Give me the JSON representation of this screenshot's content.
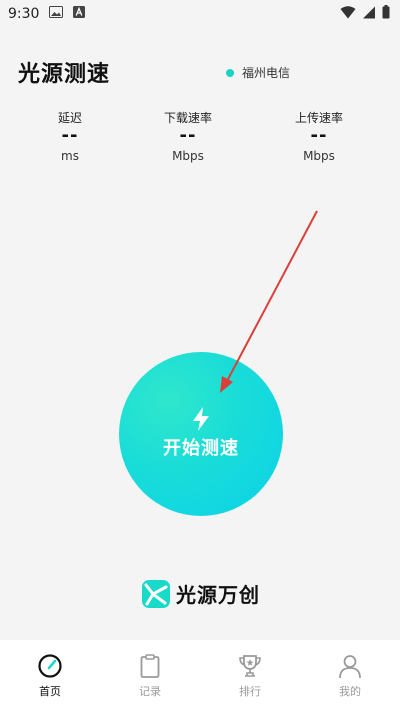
{
  "status_bar": {
    "time": "9:30"
  },
  "header": {
    "title": "光源测速",
    "isp": "福州电信"
  },
  "metrics": [
    {
      "label": "延迟",
      "value": "--",
      "unit": "ms"
    },
    {
      "label": "下载速率",
      "value": "--",
      "unit": "Mbps"
    },
    {
      "label": "上传速率",
      "value": "--",
      "unit": "Mbps"
    }
  ],
  "start_button": {
    "label": "开始测速"
  },
  "brand": {
    "name": "光源万创"
  },
  "nav": {
    "items": [
      {
        "label": "首页",
        "icon": "speedometer-icon"
      },
      {
        "label": "记录",
        "icon": "clipboard-icon"
      },
      {
        "label": "排行",
        "icon": "trophy-icon"
      },
      {
        "label": "我的",
        "icon": "profile-icon"
      }
    ],
    "active_index": 0
  },
  "colors": {
    "accent": "#19dcd8",
    "isp_dot": "#19d3c5",
    "arrow": "#d9403a"
  }
}
